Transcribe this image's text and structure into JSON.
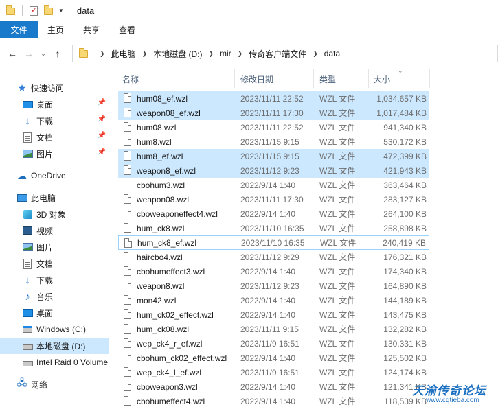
{
  "window": {
    "title": "data"
  },
  "ribbon": {
    "tabs": [
      "文件",
      "主页",
      "共享",
      "查看"
    ]
  },
  "address": {
    "crumbs": [
      "此电脑",
      "本地磁盘 (D:)",
      "mir",
      "传奇客户端文件",
      "data"
    ]
  },
  "sidebar": {
    "items": [
      {
        "label": "快速访问",
        "icon": "star-icon"
      },
      {
        "label": "桌面",
        "icon": "desktop-icon",
        "pinned": true
      },
      {
        "label": "下载",
        "icon": "download-icon",
        "pinned": true
      },
      {
        "label": "文档",
        "icon": "document-icon",
        "pinned": true
      },
      {
        "label": "图片",
        "icon": "picture-icon",
        "pinned": true
      },
      {
        "label": "OneDrive",
        "icon": "cloud-icon"
      },
      {
        "label": "此电脑",
        "icon": "computer-icon"
      },
      {
        "label": "3D 对象",
        "icon": "cube-icon"
      },
      {
        "label": "视频",
        "icon": "video-icon"
      },
      {
        "label": "图片",
        "icon": "picture-icon"
      },
      {
        "label": "文档",
        "icon": "document-icon"
      },
      {
        "label": "下载",
        "icon": "download-icon"
      },
      {
        "label": "音乐",
        "icon": "music-icon"
      },
      {
        "label": "桌面",
        "icon": "desktop-icon"
      },
      {
        "label": "Windows (C:)",
        "icon": "windows-drive-icon"
      },
      {
        "label": "本地磁盘 (D:)",
        "icon": "drive-icon",
        "selected": true
      },
      {
        "label": "Intel Raid 0 Volume",
        "icon": "drive-icon"
      },
      {
        "label": "网络",
        "icon": "network-icon"
      }
    ]
  },
  "columns": {
    "name": "名称",
    "date": "修改日期",
    "type": "类型",
    "size": "大小"
  },
  "files": [
    {
      "name": "hum08_ef.wzl",
      "date": "2023/11/11 22:52",
      "type": "WZL 文件",
      "size": "1,034,657 KB",
      "selected": true
    },
    {
      "name": "weapon08_ef.wzl",
      "date": "2023/11/11 17:30",
      "type": "WZL 文件",
      "size": "1,017,484 KB",
      "selected": true
    },
    {
      "name": "hum08.wzl",
      "date": "2023/11/11 22:52",
      "type": "WZL 文件",
      "size": "941,340 KB"
    },
    {
      "name": "hum8.wzl",
      "date": "2023/11/15 9:15",
      "type": "WZL 文件",
      "size": "530,172 KB"
    },
    {
      "name": "hum8_ef.wzl",
      "date": "2023/11/15 9:15",
      "type": "WZL 文件",
      "size": "472,399 KB",
      "selected": true
    },
    {
      "name": "weapon8_ef.wzl",
      "date": "2023/11/12 9:23",
      "type": "WZL 文件",
      "size": "421,943 KB",
      "selected": true
    },
    {
      "name": "cbohum3.wzl",
      "date": "2022/9/14 1:40",
      "type": "WZL 文件",
      "size": "363,464 KB"
    },
    {
      "name": "weapon08.wzl",
      "date": "2023/11/11 17:30",
      "type": "WZL 文件",
      "size": "283,127 KB"
    },
    {
      "name": "cboweaponeffect4.wzl",
      "date": "2022/9/14 1:40",
      "type": "WZL 文件",
      "size": "264,100 KB"
    },
    {
      "name": "hum_ck8.wzl",
      "date": "2023/11/10 16:35",
      "type": "WZL 文件",
      "size": "258,898 KB"
    },
    {
      "name": "hum_ck8_ef.wzl",
      "date": "2023/11/10 16:35",
      "type": "WZL 文件",
      "size": "240,419 KB",
      "focus": true
    },
    {
      "name": "haircbo4.wzl",
      "date": "2023/11/12 9:29",
      "type": "WZL 文件",
      "size": "176,321 KB"
    },
    {
      "name": "cbohumeffect3.wzl",
      "date": "2022/9/14 1:40",
      "type": "WZL 文件",
      "size": "174,340 KB"
    },
    {
      "name": "weapon8.wzl",
      "date": "2023/11/12 9:23",
      "type": "WZL 文件",
      "size": "164,890 KB"
    },
    {
      "name": "mon42.wzl",
      "date": "2022/9/14 1:40",
      "type": "WZL 文件",
      "size": "144,189 KB"
    },
    {
      "name": "hum_ck02_effect.wzl",
      "date": "2022/9/14 1:40",
      "type": "WZL 文件",
      "size": "143,475 KB"
    },
    {
      "name": "hum_ck08.wzl",
      "date": "2023/11/11 9:15",
      "type": "WZL 文件",
      "size": "132,282 KB"
    },
    {
      "name": "wep_ck4_r_ef.wzl",
      "date": "2023/11/9 16:51",
      "type": "WZL 文件",
      "size": "130,331 KB"
    },
    {
      "name": "cbohum_ck02_effect.wzl",
      "date": "2022/9/14 1:40",
      "type": "WZL 文件",
      "size": "125,502 KB"
    },
    {
      "name": "wep_ck4_l_ef.wzl",
      "date": "2023/11/9 16:51",
      "type": "WZL 文件",
      "size": "124,174 KB"
    },
    {
      "name": "cboweapon3.wzl",
      "date": "2022/9/14 1:40",
      "type": "WZL 文件",
      "size": "121,341 KB"
    },
    {
      "name": "cbohumeffect4.wzl",
      "date": "2022/9/14 1:40",
      "type": "WZL 文件",
      "size": "118,539 KB"
    }
  ],
  "watermark": {
    "logo": "天渝传奇论坛",
    "url": "www.cqtieba.com"
  },
  "colors": {
    "accent": "#1979ca",
    "selection": "#cce8ff",
    "folder": "#f8d775"
  }
}
